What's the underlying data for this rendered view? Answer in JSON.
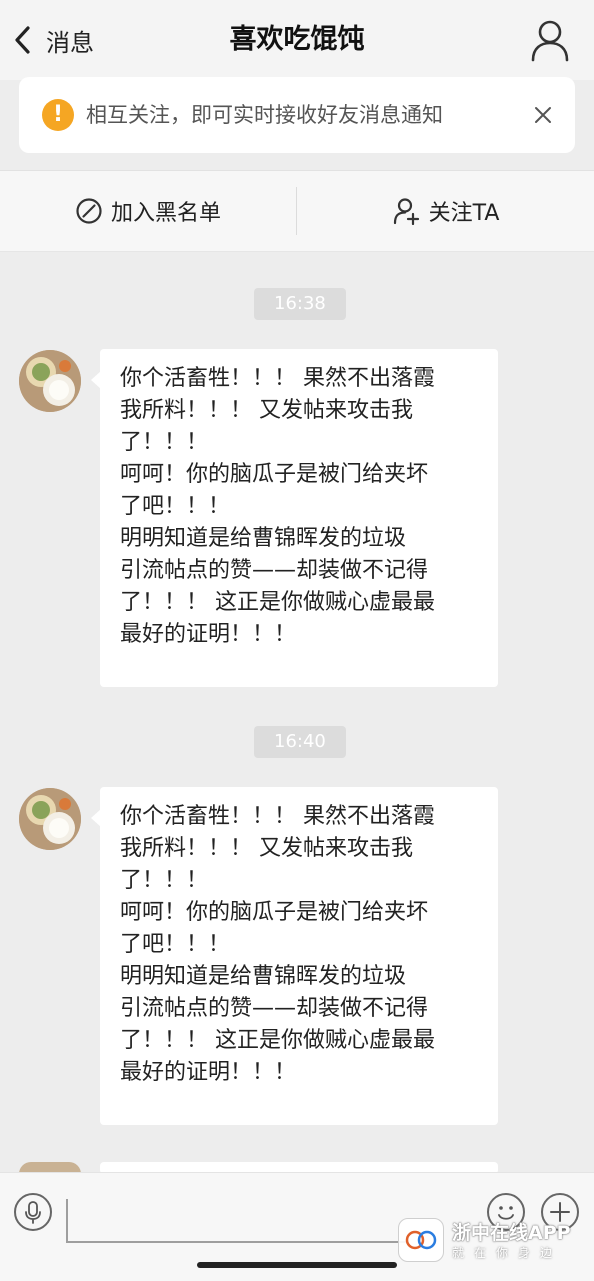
{
  "nav": {
    "back_label": "消息",
    "title": "喜欢吃馄饨"
  },
  "notice": {
    "text": "相互关注，即可实时接收好友消息通知"
  },
  "actions": {
    "blacklist_label": "加入黑名单",
    "follow_label": "关注TA"
  },
  "messages": [
    {
      "time": "16:38",
      "lines": [
        "你个活畜牲！！！ 果然不出落霞",
        "我所料！！！ 又发帖来攻击我",
        "了！！！",
        "呵呵！你的脑瓜子是被门给夹坏",
        "了吧！！！",
        "明明知道是给曹锦晖发的垃圾",
        "引流帖点的赞——却装做不记得",
        "了！！！ 这正是你做贼心虚最最",
        "最好的证明！！！"
      ]
    },
    {
      "time": "16:40",
      "lines": [
        "你个活畜牲！！！ 果然不出落霞",
        "我所料！！！ 又发帖来攻击我",
        "了！！！",
        "呵呵！你的脑瓜子是被门给夹坏",
        "了吧！！！",
        "明明知道是给曹锦晖发的垃圾",
        "引流帖点的赞——却装做不记得",
        "了！！！ 这正是你做贼心虚最最",
        "最好的证明！！！"
      ]
    }
  ],
  "watermark": {
    "name": "浙中在线APP",
    "sub": "就在你身边"
  },
  "icons": [
    "back-chevron-icon",
    "user-profile-icon",
    "warning-icon",
    "close-icon",
    "block-icon",
    "add-user-icon",
    "microphone-icon",
    "emoji-icon",
    "plus-icon"
  ],
  "colors": {
    "warning": "#f5a623",
    "background": "#ededed",
    "bubble": "#ffffff"
  }
}
